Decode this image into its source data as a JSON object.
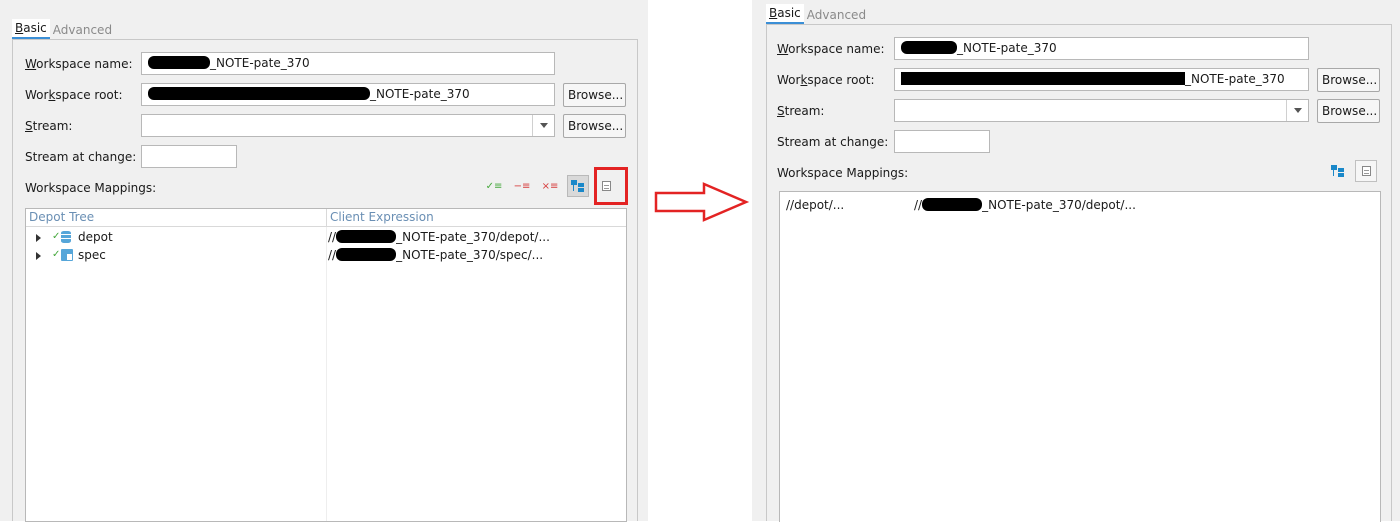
{
  "tabs": [
    {
      "label_accel": "B",
      "label_rest": "asic"
    },
    {
      "label": "Advanced"
    }
  ],
  "form": {
    "workspace_name_label_pre": "",
    "workspace_name_label_accel": "W",
    "workspace_name_label_rest": "orkspace name:",
    "workspace_name_suffix": "_NOTE-pate_370",
    "workspace_root_label_pre": "Wor",
    "workspace_root_label_accel": "k",
    "workspace_root_label_rest": "space root:",
    "workspace_root_suffix": "_NOTE-pate_370",
    "stream_label_accel": "S",
    "stream_label_rest": "tream:",
    "stream_at_change_label": "Stream at change:",
    "browse_pre": "Brows",
    "browse_accel": "e",
    "browse_post": "...",
    "mappings_label": "Workspace Mappings:"
  },
  "tree": {
    "col_depot": "Depot Tree",
    "col_client": "Client Expression",
    "rows": [
      {
        "name": "depot",
        "prefix": "//",
        "suffix": "_NOTE-pate_370/depot/..."
      },
      {
        "name": "spec",
        "prefix": "//",
        "suffix": "_NOTE-pate_370/spec/..."
      }
    ]
  },
  "text_view": {
    "depot": "//depot/...",
    "client_prefix": "//",
    "client_suffix": "_NOTE-pate_370/depot/..."
  },
  "icons": {
    "add": "✓≡",
    "remove": "−≡",
    "delete": "×≡"
  },
  "colors": {
    "highlight": "#e32323",
    "arrow": "#e32323",
    "accent": "#3b8fd6"
  }
}
